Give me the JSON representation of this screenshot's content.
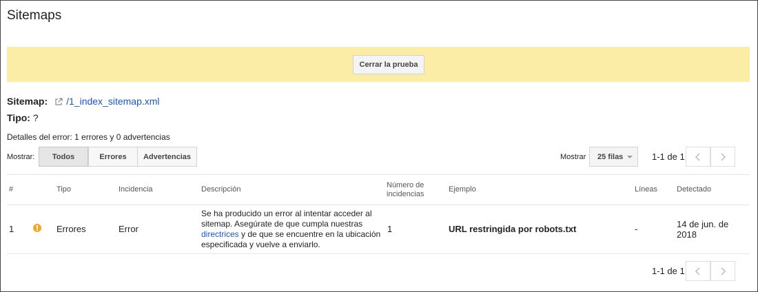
{
  "page": {
    "title": "Sitemaps"
  },
  "banner": {
    "close_test_label": "Cerrar la prueba",
    "color": "#fbeca6"
  },
  "sitemap": {
    "label": "Sitemap:",
    "link_text": "/1_index_sitemap.xml",
    "link_color": "#1a55c8"
  },
  "type": {
    "label": "Tipo:",
    "value": "?"
  },
  "details": {
    "text": "Detalles del error: 1 errores y 0 advertencias"
  },
  "filter": {
    "show_label": "Mostrar:",
    "options": [
      "Todos",
      "Errores",
      "Advertencias"
    ],
    "selected": "Todos"
  },
  "pagination": {
    "show_label": "Mostrar",
    "rows_value": "25 filas",
    "range_text": "1-1 de 1"
  },
  "table": {
    "headers": {
      "num": "#",
      "type": "Tipo",
      "issue": "Incidencia",
      "description": "Descripción",
      "count_line1": "Número de",
      "count_line2": "incidencias",
      "example": "Ejemplo",
      "lines": "Líneas",
      "detected": "Detectado"
    },
    "rows": [
      {
        "num": "1",
        "status_icon": "warning-icon",
        "type": "Errores",
        "issue": "Error",
        "description_before": "Se ha producido un error al intentar acceder al sitemap. Asegúrate de que cumpla nuestras ",
        "description_link": "directrices",
        "description_after": " y de que se encuentre en la ubicación especificada y vuelve a enviarlo.",
        "count": "1",
        "example": "URL restringida por robots.txt",
        "lines": "-",
        "detected": "14 de jun. de 2018"
      }
    ]
  }
}
